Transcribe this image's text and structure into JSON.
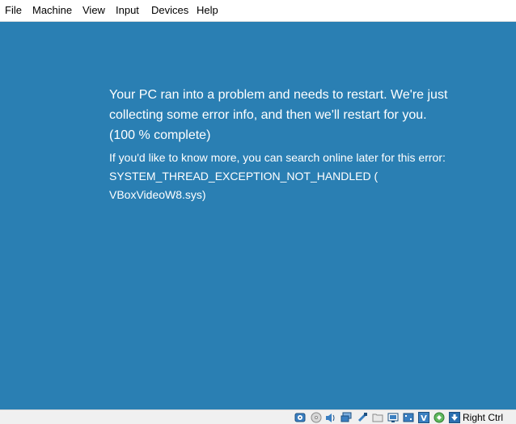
{
  "menubar": {
    "items": [
      "File",
      "Machine",
      "View",
      "Input",
      "Devices",
      "Help"
    ]
  },
  "guest_screen": {
    "background": "#2a7fb3",
    "message": "Your PC ran into a problem and needs to restart. We're just collecting some error info, and then we'll restart for you. (100 % complete)",
    "detail": "If you'd like to know more, you can search online later for this error: SYSTEM_THREAD_EXCEPTION_NOT_HANDLED ( VBoxVideoW8.sys)"
  },
  "statusbar": {
    "icons": [
      "hard-disk-icon",
      "optical-drive-icon",
      "audio-icon",
      "network-icon",
      "usb-icon",
      "shared-folders-icon",
      "display-icon",
      "video-capture-icon",
      "virtualization-icon",
      "mouse-integration-icon",
      "keyboard-capture-icon"
    ],
    "host_key": "Right Ctrl"
  }
}
